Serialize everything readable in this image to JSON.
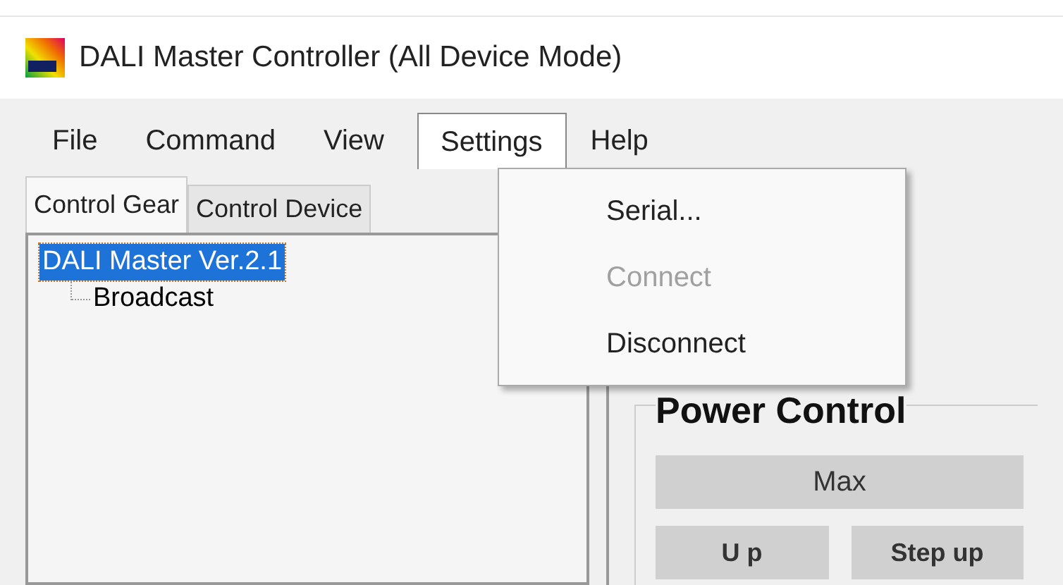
{
  "window": {
    "title": "DALI Master Controller (All Device Mode)"
  },
  "menu_bar": [
    {
      "label": "File",
      "selected": false
    },
    {
      "label": "Command",
      "selected": false
    },
    {
      "label": "View",
      "selected": false
    },
    {
      "label": "Settings",
      "selected": true
    },
    {
      "label": "Help",
      "selected": false
    }
  ],
  "dropdown": [
    {
      "label": "Serial...",
      "disabled": false
    },
    {
      "label": "Connect",
      "disabled": true
    },
    {
      "label": "Disconnect",
      "disabled": false
    }
  ],
  "tabs": [
    {
      "label": "Control Gear",
      "selected": true
    },
    {
      "label": "Control Device",
      "selected": false
    }
  ],
  "tree": [
    {
      "label": "DALI Master Ver.2.1",
      "selected": true,
      "children": [
        {
          "label": "Broadcast",
          "selected": false
        }
      ]
    }
  ],
  "power_control": {
    "title": "Power Control",
    "buttons": [
      {
        "label": "Max",
        "kind": "wide"
      },
      {
        "label": "U p",
        "kind": "half"
      },
      {
        "label": "Step up",
        "kind": "half"
      }
    ]
  }
}
